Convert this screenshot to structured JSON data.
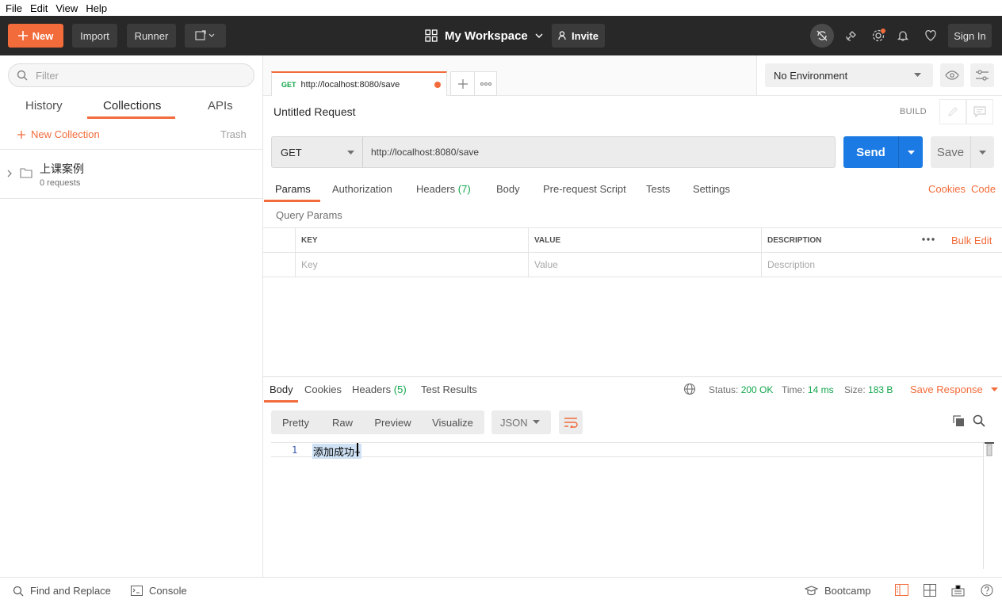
{
  "menubar": {
    "items": [
      "File",
      "Edit",
      "View",
      "Help"
    ]
  },
  "header": {
    "new_label": "New",
    "import_label": "Import",
    "runner_label": "Runner",
    "workspace_label": "My Workspace",
    "invite_label": "Invite",
    "signin_label": "Sign In",
    "accent": "#f26b3a"
  },
  "sidebar": {
    "filter_placeholder": "Filter",
    "tabs": {
      "history": "History",
      "collections": "Collections",
      "apis": "APIs"
    },
    "new_collection": "New Collection",
    "trash": "Trash",
    "collection": {
      "name": "上课案例",
      "count": "0 requests"
    }
  },
  "tab": {
    "method": "GET",
    "url": "http://localhost:8080/save"
  },
  "environment": {
    "selected": "No Environment"
  },
  "request": {
    "title": "Untitled Request",
    "build": "BUILD",
    "method": "GET",
    "url": "http://localhost:8080/save",
    "send": "Send",
    "save": "Save",
    "tabs": {
      "params": "Params",
      "authorization": "Authorization",
      "headers": "Headers",
      "headers_count": "(7)",
      "body": "Body",
      "prerequest": "Pre-request Script",
      "tests": "Tests",
      "settings": "Settings"
    },
    "cookies": "Cookies",
    "code": "Code",
    "query_params": "Query Params",
    "table": {
      "headers": [
        "KEY",
        "VALUE",
        "DESCRIPTION"
      ],
      "placeholders": [
        "Key",
        "Value",
        "Description"
      ],
      "bulk_edit": "Bulk Edit"
    }
  },
  "response": {
    "tabs": {
      "body": "Body",
      "cookies": "Cookies",
      "headers": "Headers",
      "headers_count": "(5)",
      "tests": "Test Results"
    },
    "status_label": "Status:",
    "status_value": "200 OK",
    "time_label": "Time:",
    "time_value": "14 ms",
    "size_label": "Size:",
    "size_value": "183 B",
    "save_response": "Save Response",
    "formats": [
      "Pretty",
      "Raw",
      "Preview",
      "Visualize"
    ],
    "language": "JSON",
    "line_number": "1",
    "line_text": "添加成功~"
  },
  "footer": {
    "find_replace": "Find and Replace",
    "console": "Console",
    "bootcamp": "Bootcamp"
  }
}
